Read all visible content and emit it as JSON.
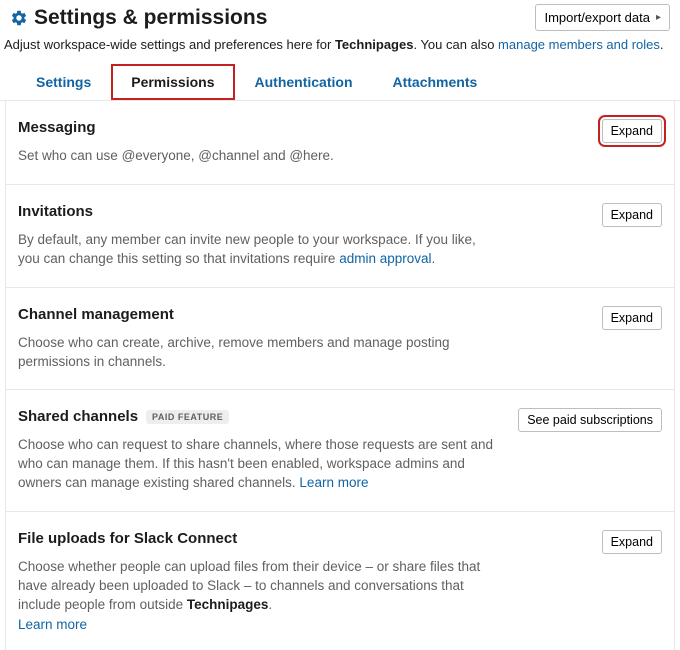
{
  "header": {
    "title": "Settings & permissions",
    "import_btn": "Import/export data"
  },
  "subheader": {
    "text_before": "Adjust workspace-wide settings and preferences here for ",
    "workspace": "Technipages",
    "text_after": ". You can also ",
    "link": "manage members and roles",
    "period": "."
  },
  "tabs": {
    "settings": "Settings",
    "permissions": "Permissions",
    "authentication": "Authentication",
    "attachments": "Attachments"
  },
  "buttons": {
    "expand": "Expand",
    "see_paid": "See paid subscriptions"
  },
  "badges": {
    "paid_feature": "PAID FEATURE"
  },
  "sections": {
    "messaging": {
      "title": "Messaging",
      "desc": "Set who can use @everyone, @channel and @here."
    },
    "invitations": {
      "title": "Invitations",
      "desc_before": "By default, any member can invite new people to your workspace. If you like, you can change this setting so that invitations require ",
      "link": "admin approval",
      "desc_after": "."
    },
    "channel_mgmt": {
      "title": "Channel management",
      "desc": "Choose who can create, archive, remove members and manage posting permissions in channels."
    },
    "shared_channels": {
      "title": "Shared channels",
      "desc_before": "Choose who can request to share channels, where those requests are sent and who can manage them. If this hasn't been enabled, workspace admins and owners can manage existing shared channels. ",
      "learn_more": "Learn more"
    },
    "file_uploads": {
      "title": "File uploads for Slack Connect",
      "desc_before": "Choose whether people can upload files from their device – or share files that have already been uploaded to Slack – to channels and conversations that include people from outside ",
      "workspace": "Technipages",
      "desc_after": ".",
      "learn_more": "Learn more"
    }
  }
}
